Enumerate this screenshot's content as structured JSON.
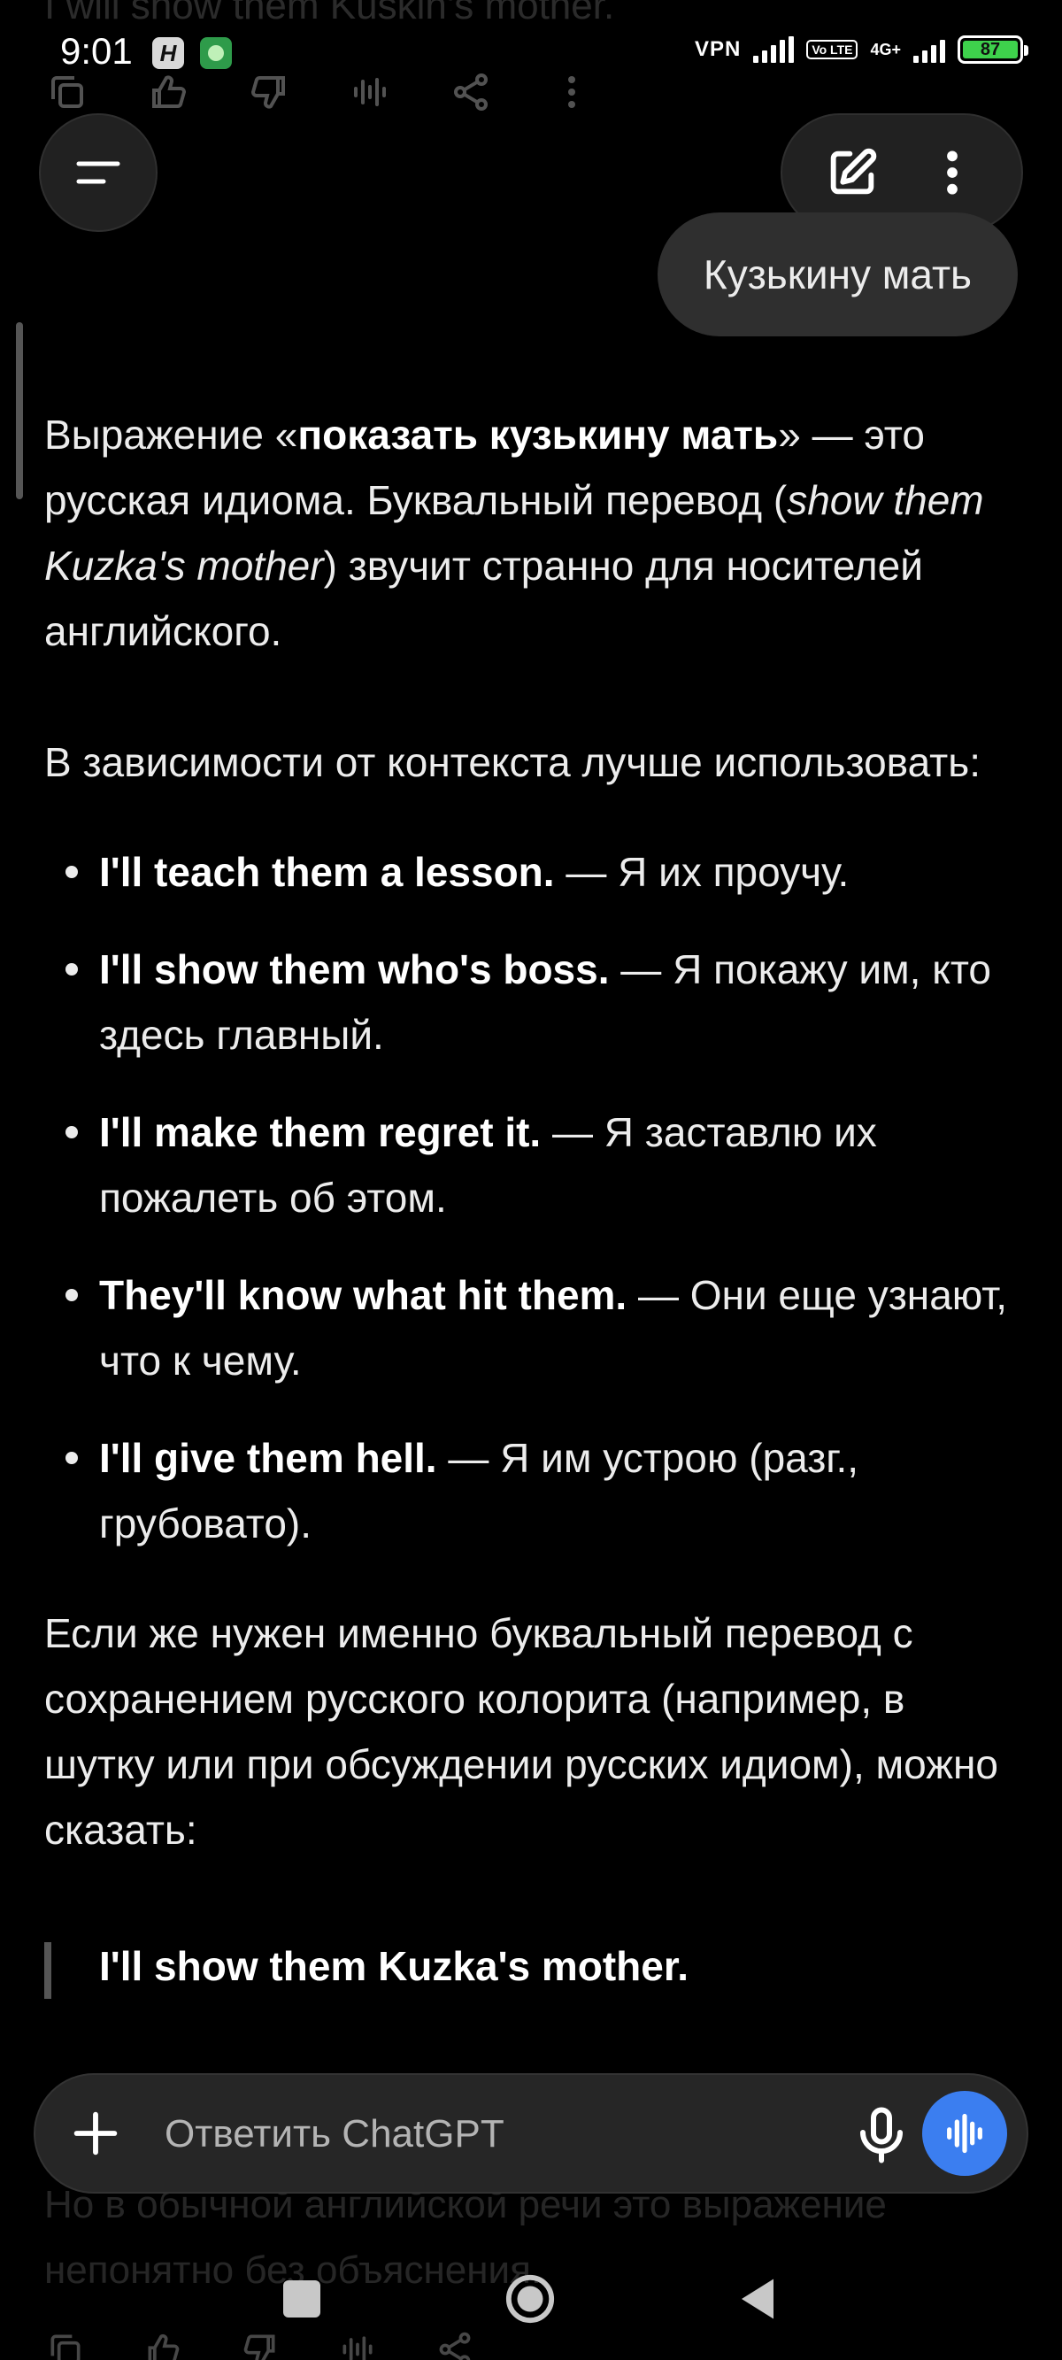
{
  "previous": {
    "ghost_text": "I will show them Kuskin's mother."
  },
  "status_bar": {
    "time": "9:01",
    "vpn": "VPN",
    "volte": "Vo LTE",
    "network": "4G+",
    "battery": "87"
  },
  "user_message": "Кузькину мать",
  "assistant": {
    "p1": {
      "a": "Выражение «",
      "b": "показать кузькину мать",
      "c": "» — это русская идиома. Буквальный перевод (",
      "d": "show them Kuzka's mother",
      "e": ") звучит странно для носителей английского."
    },
    "p2": "В зависимости от контекста лучше использовать:",
    "options": [
      {
        "en": "I'll teach them a lesson.",
        "ru": " — Я их проучу."
      },
      {
        "en": "I'll show them who's boss.",
        "ru": " — Я покажу им, кто здесь главный."
      },
      {
        "en": "I'll make them regret it.",
        "ru": " — Я заставлю их пожалеть об этом."
      },
      {
        "en": "They'll know what hit them.",
        "ru": " — Они еще узнают, что к чему."
      },
      {
        "en": "I'll give them hell.",
        "ru": " — Я им устрою (разг., грубовато)."
      }
    ],
    "p3": "Если же нужен именно буквальный перевод с сохранением русского колорита (например, в шутку или при обсуждении русских идиом), можно сказать:",
    "quote": "I'll show them Kuzka's mother.",
    "p4": "Но в обычной английской речи это выражение непонятно без объяснения."
  },
  "composer": {
    "placeholder": "Ответить ChatGPT"
  },
  "icons": {
    "menu": "menu-icon",
    "new_chat": "new-chat-icon",
    "more": "more-vertical-icon",
    "plus": "plus-icon",
    "mic": "mic-icon",
    "voice": "voice-mode-icon"
  },
  "colors": {
    "background": "#000000",
    "bubble": "#2f2f2f",
    "accent": "#3b7ef0",
    "battery": "#3ed14c"
  }
}
